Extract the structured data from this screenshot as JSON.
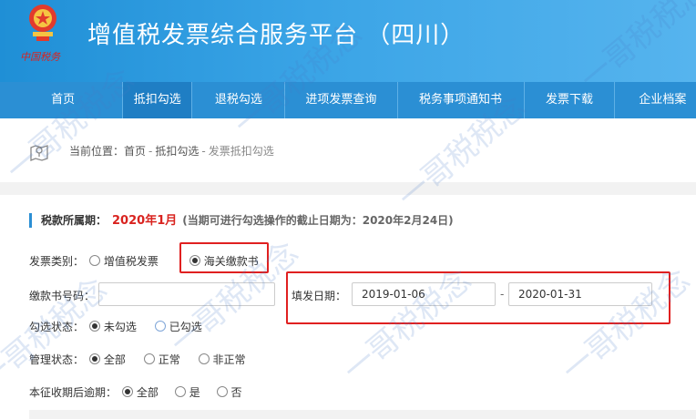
{
  "header": {
    "emblem_text": "中国税务",
    "title": "增值税发票综合服务平台 （四川）"
  },
  "nav": {
    "items": [
      {
        "label": "首页"
      },
      {
        "label": "抵扣勾选"
      },
      {
        "label": "退税勾选"
      },
      {
        "label": "进项发票查询"
      },
      {
        "label": "税务事项通知书"
      },
      {
        "label": "发票下载"
      },
      {
        "label": "企业档案"
      }
    ]
  },
  "breadcrumb": {
    "prefix": "当前位置：",
    "items": [
      "首页",
      "抵扣勾选",
      "发票抵扣勾选"
    ],
    "separator": "-"
  },
  "period": {
    "label": "税款所属期：",
    "value": "2020年1月",
    "hint": "(当期可进行勾选操作的截止日期为：2020年2月24日)"
  },
  "form": {
    "invoice_type": {
      "label": "发票类别：",
      "options": [
        "增值税发票",
        "海关缴款书"
      ],
      "selected": "海关缴款书"
    },
    "payment_no": {
      "label": "缴款书号码：",
      "value": ""
    },
    "issue_date": {
      "label": "填发日期：",
      "from": "2019-01-06",
      "dash": "-",
      "to": "2020-01-31"
    },
    "check_status": {
      "label": "勾选状态：",
      "options": [
        "未勾选",
        "已勾选"
      ],
      "selected": "未勾选"
    },
    "mgmt_status": {
      "label": "管理状态：",
      "options": [
        "全部",
        "正常",
        "非正常"
      ],
      "selected": "全部"
    },
    "overdue": {
      "label": "本征收期后逾期：",
      "options": [
        "全部",
        "是",
        "否"
      ],
      "selected": "全部"
    }
  },
  "watermark": {
    "text": "一哥税税念"
  },
  "colors": {
    "header_blue": "#2b8fd4",
    "accent_red": "#d9231f",
    "highlight_border": "#e02020"
  }
}
